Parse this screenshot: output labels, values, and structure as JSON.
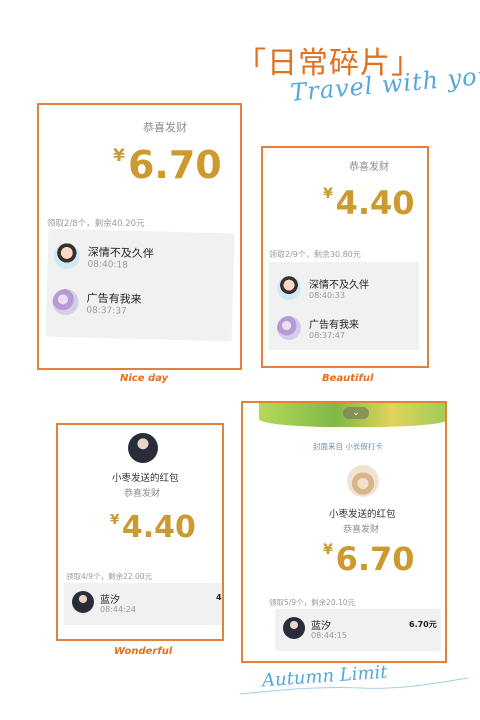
{
  "header": {
    "title": "「日常碎片」",
    "subtitle": "Travel with you"
  },
  "footer": {
    "signature": "Autumn Limit"
  },
  "cards": [
    {
      "caption": "Nice day",
      "greeting": "恭喜发财",
      "currency": "¥",
      "amount": "6.70",
      "summary": "领取2/8个，剩余40.20元",
      "rows": [
        {
          "name": "深情不及久伴",
          "time": "08:40:18"
        },
        {
          "name": "广告有我来",
          "time": "08:37:37"
        }
      ]
    },
    {
      "caption": "Beautiful",
      "greeting": "恭喜发财",
      "currency": "¥",
      "amount": "4.40",
      "summary": "领取2/9个，剩余30.80元",
      "rows": [
        {
          "name": "深情不及久伴",
          "time": "08:40:33"
        },
        {
          "name": "广告有我来",
          "time": "08:37:47"
        }
      ]
    },
    {
      "caption": "Wonderful",
      "sender": "小枣发送的红包",
      "greeting": "恭喜发财",
      "currency": "¥",
      "amount": "4.40",
      "summary": "领取4/9个，剩余22.00元",
      "rows": [
        {
          "name": "蓝汐",
          "time": "08:44:24",
          "amount": "4"
        }
      ]
    },
    {
      "cover_text": "封面来自 小长假打卡",
      "sender": "小枣发送的红包",
      "greeting": "恭喜发财",
      "currency": "¥",
      "amount": "6.70",
      "summary": "领取5/9个，剩余20.10元",
      "rows": [
        {
          "name": "蓝汐",
          "time": "08:44:15",
          "amount": "6.70元"
        }
      ]
    }
  ]
}
